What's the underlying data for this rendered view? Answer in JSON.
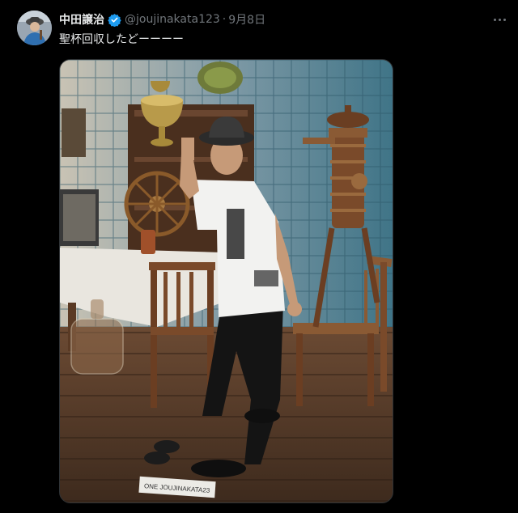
{
  "tweet": {
    "author_name": "中田譲治",
    "handle": "@joujinakata123",
    "separator": "·",
    "date": "9月8日",
    "text": "聖杯回収したどーーーー",
    "more_icon": "more-horizontal-icon",
    "verified_icon": "verified-badge-icon",
    "verified_color": "#1d9bf0"
  },
  "photo": {
    "sign_text": "ONE JOUJINAKATA23"
  }
}
